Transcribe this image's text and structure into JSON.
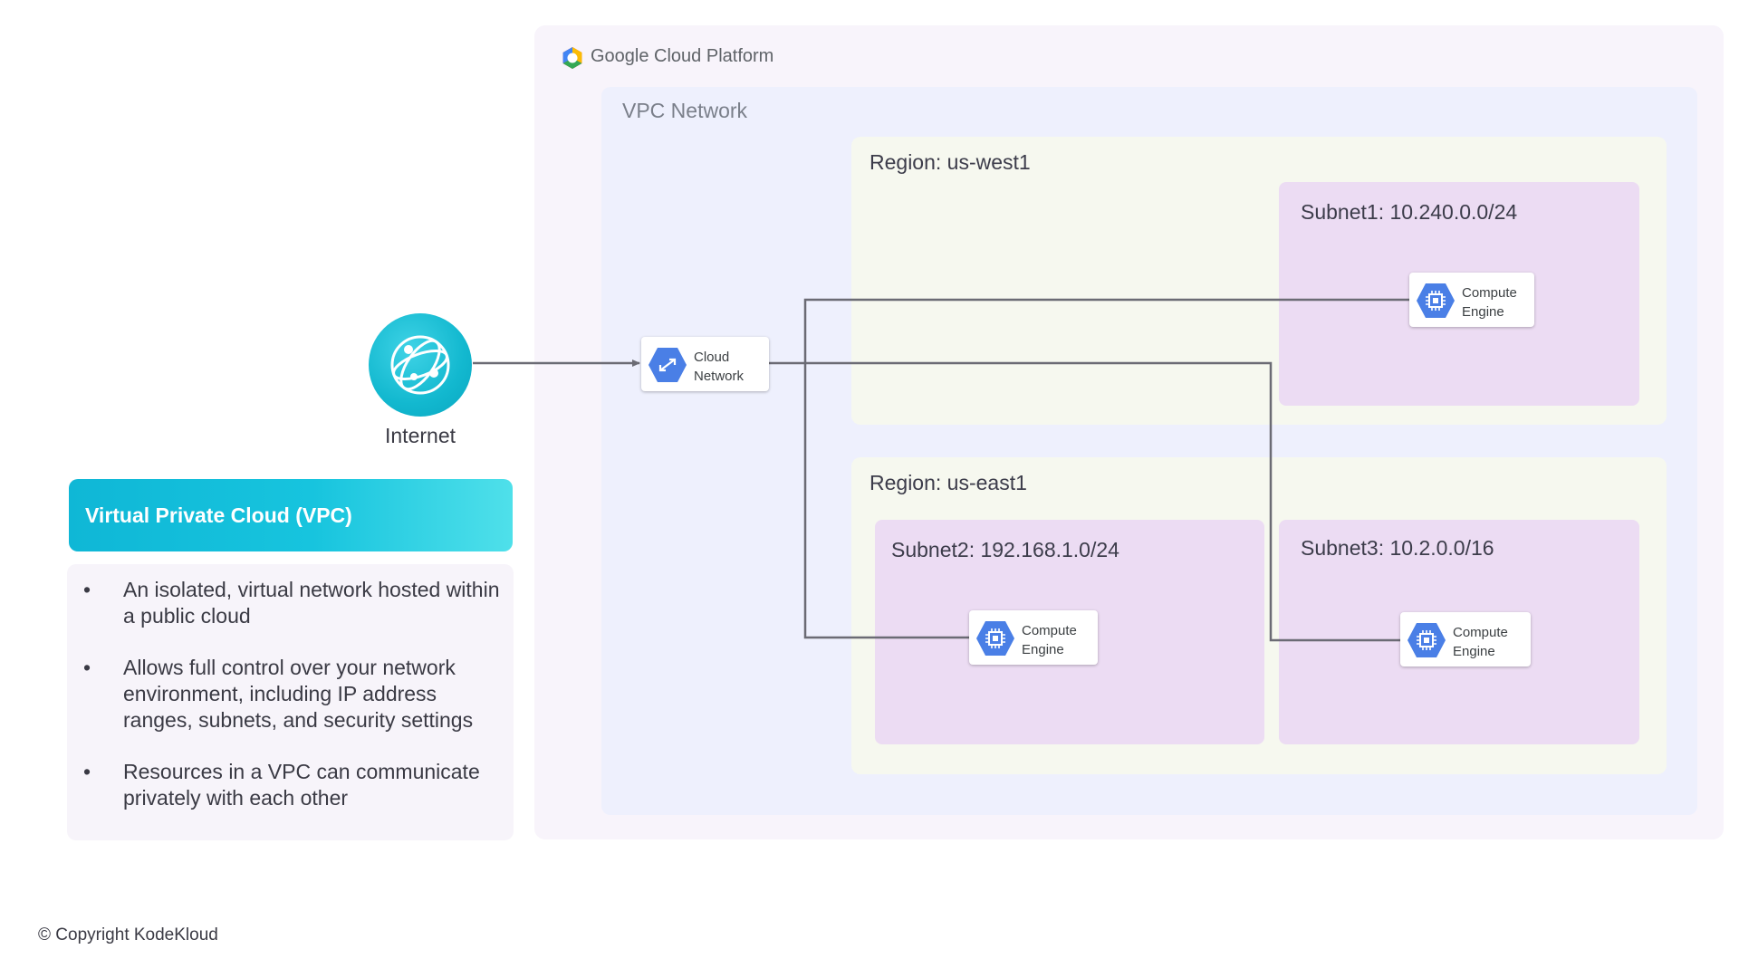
{
  "internet": {
    "label": "Internet",
    "icon": "globe-icon"
  },
  "vpc_info": {
    "title": "Virtual Private Cloud (VPC)",
    "bullets": [
      {
        "marker": "•",
        "text": "An isolated, virtual network hosted within a public cloud"
      },
      {
        "marker": "•",
        "text": "Allows full control over your network environment, including IP address ranges, subnets, and security settings"
      },
      {
        "marker": "•",
        "text": "Resources in a VPC can communicate privately with each other"
      }
    ]
  },
  "gcp": {
    "title": "Google Cloud Platform",
    "vpc_network_label": "VPC Network",
    "cloud_network": {
      "line1": "Cloud",
      "line2": "Network",
      "icon": "cloud-network-icon"
    },
    "regions": [
      {
        "label": "Region: us-west1"
      },
      {
        "label": "Region: us-east1"
      }
    ],
    "subnets": [
      {
        "label": "Subnet1: 10.240.0.0/24"
      },
      {
        "label": "Subnet2: 192.168.1.0/24"
      },
      {
        "label": "Subnet3: 10.2.0.0/16"
      }
    ],
    "compute_engine": {
      "line1": "Compute",
      "line2": "Engine",
      "icon": "compute-engine-icon"
    }
  },
  "footer": {
    "copyright": "© Copyright KodeKloud"
  },
  "colors": {
    "accent_cyan": "#12b8cf",
    "gcp_blue": "#4a7fe6",
    "subnet_purple": "#ecdcf3",
    "region_green": "#f6f8ef",
    "vpc_blue": "#eef0fd"
  }
}
